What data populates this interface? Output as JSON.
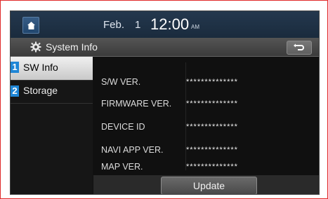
{
  "status_bar": {
    "date": "Feb.",
    "day": "1",
    "time": "12:00",
    "ampm": "AM"
  },
  "header": {
    "title": "System Info"
  },
  "sidebar": {
    "items": [
      {
        "marker": "1",
        "label": "SW Info",
        "selected": true
      },
      {
        "marker": "2",
        "label": "Storage",
        "selected": false
      }
    ]
  },
  "details": {
    "rows": [
      {
        "label": "S/W VER.",
        "value": "**************"
      },
      {
        "label": "FIRMWARE VER.",
        "value": "**************"
      },
      {
        "label": "DEVICE ID",
        "value": "**************"
      },
      {
        "label": "NAVI APP VER.",
        "value": "**************"
      },
      {
        "label": "MAP VER.",
        "value": "**************"
      }
    ]
  },
  "actions": {
    "update_label": "Update"
  },
  "colors": {
    "accent": "#1f86d6",
    "frame": "#e02a2a",
    "selected_row": "#d6d6d6"
  },
  "icons": {
    "home": "home-icon",
    "gear": "gear-icon",
    "back": "back-arrow-icon"
  }
}
